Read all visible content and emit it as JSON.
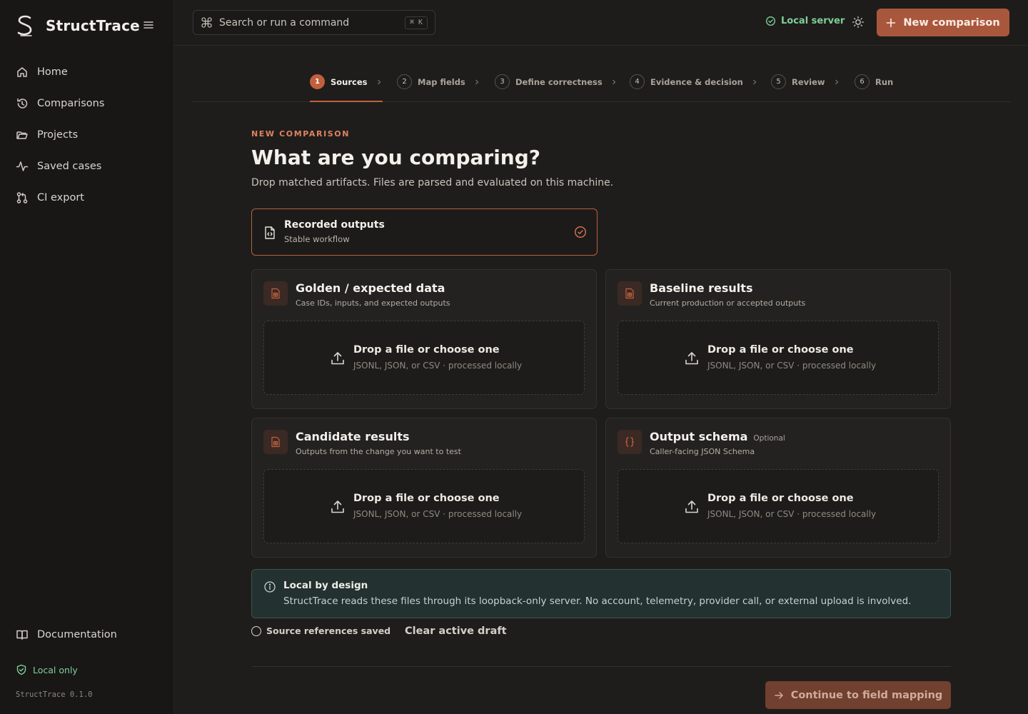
{
  "app": {
    "name": "StructTrace",
    "version": "StructTrace 0.1.0"
  },
  "sidebar": {
    "items": [
      {
        "label": "Home",
        "icon": "home-icon"
      },
      {
        "label": "Comparisons",
        "icon": "history-icon"
      },
      {
        "label": "Projects",
        "icon": "folder-icon"
      },
      {
        "label": "Saved cases",
        "icon": "activity-icon"
      },
      {
        "label": "CI export",
        "icon": "git-pull-request-icon"
      }
    ],
    "documentation": "Documentation",
    "local_badge": "Local only"
  },
  "topbar": {
    "search_placeholder": "Search or run a command",
    "search_shortcut": "⌘ K",
    "server_status": "Local server",
    "new_button": "New comparison"
  },
  "steps": [
    {
      "num": "1",
      "label": "Sources",
      "active": true
    },
    {
      "num": "2",
      "label": "Map fields"
    },
    {
      "num": "3",
      "label": "Define correctness"
    },
    {
      "num": "4",
      "label": "Evidence & decision"
    },
    {
      "num": "5",
      "label": "Review"
    },
    {
      "num": "6",
      "label": "Run"
    }
  ],
  "page": {
    "eyebrow": "NEW COMPARISON",
    "title": "What are you comparing?",
    "subtitle": "Drop matched artifacts. Files are parsed and evaluated on this machine."
  },
  "mode": {
    "title": "Recorded outputs",
    "subtitle": "Stable workflow"
  },
  "cards": [
    {
      "title": "Golden / expected data",
      "subtitle": "Case IDs, inputs, and expected outputs",
      "optional": ""
    },
    {
      "title": "Baseline results",
      "subtitle": "Current production or accepted outputs",
      "optional": ""
    },
    {
      "title": "Candidate results",
      "subtitle": "Outputs from the change you want to test",
      "optional": ""
    },
    {
      "title": "Output schema",
      "subtitle": "Caller-facing JSON Schema",
      "optional": "Optional"
    }
  ],
  "dropzone": {
    "title": "Drop a file or choose one",
    "subtitle": "JSONL, JSON, or CSV · processed locally"
  },
  "notice": {
    "title": "Local by design",
    "body": "StructTrace reads these files through its loopback-only server. No account, telemetry, provider call, or external upload is involved."
  },
  "footer": {
    "saved_label": "Source references saved",
    "clear_label": "Clear active draft",
    "continue_label": "Continue to field mapping"
  },
  "colors": {
    "accent": "#c05f3e",
    "success": "#7fcf9a",
    "background": "#1e1d1b"
  }
}
